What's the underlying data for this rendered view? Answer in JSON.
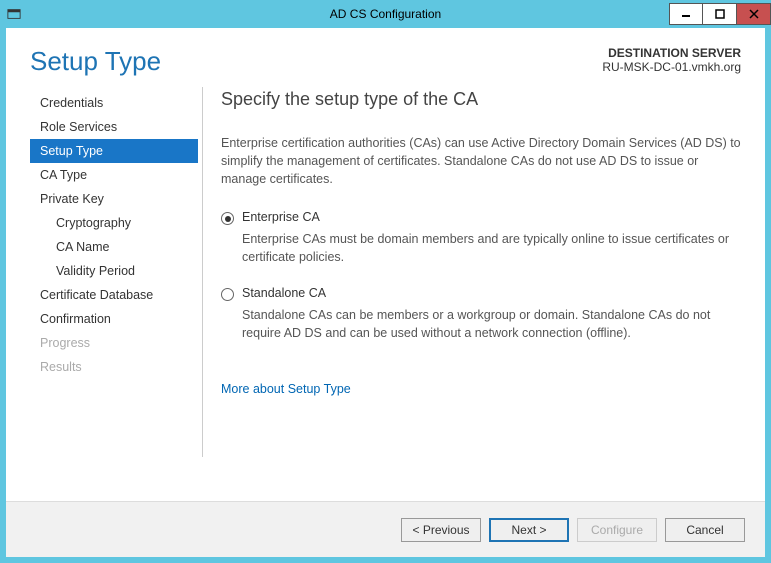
{
  "titlebar": {
    "title": "AD CS Configuration"
  },
  "header": {
    "page_title": "Setup Type",
    "destination_label": "DESTINATION SERVER",
    "destination_value": "RU-MSK-DC-01.vmkh.org"
  },
  "sidebar": {
    "items": [
      {
        "label": "Credentials",
        "indent": false,
        "selected": false,
        "disabled": false
      },
      {
        "label": "Role Services",
        "indent": false,
        "selected": false,
        "disabled": false
      },
      {
        "label": "Setup Type",
        "indent": false,
        "selected": true,
        "disabled": false
      },
      {
        "label": "CA Type",
        "indent": false,
        "selected": false,
        "disabled": false
      },
      {
        "label": "Private Key",
        "indent": false,
        "selected": false,
        "disabled": false
      },
      {
        "label": "Cryptography",
        "indent": true,
        "selected": false,
        "disabled": false
      },
      {
        "label": "CA Name",
        "indent": true,
        "selected": false,
        "disabled": false
      },
      {
        "label": "Validity Period",
        "indent": true,
        "selected": false,
        "disabled": false
      },
      {
        "label": "Certificate Database",
        "indent": false,
        "selected": false,
        "disabled": false
      },
      {
        "label": "Confirmation",
        "indent": false,
        "selected": false,
        "disabled": false
      },
      {
        "label": "Progress",
        "indent": false,
        "selected": false,
        "disabled": true
      },
      {
        "label": "Results",
        "indent": false,
        "selected": false,
        "disabled": true
      }
    ]
  },
  "content": {
    "heading": "Specify the setup type of the CA",
    "description": "Enterprise certification authorities (CAs) can use Active Directory Domain Services (AD DS) to simplify the management of certificates. Standalone CAs do not use AD DS to issue or manage certificates.",
    "options": [
      {
        "label": "Enterprise CA",
        "checked": true,
        "desc": "Enterprise CAs must be domain members and are typically online to issue certificates or certificate policies."
      },
      {
        "label": "Standalone CA",
        "checked": false,
        "desc": "Standalone CAs can be members or a workgroup or domain. Standalone CAs do not require AD DS and can be used without a network connection (offline)."
      }
    ],
    "more_link": "More about Setup Type"
  },
  "footer": {
    "previous": "< Previous",
    "next": "Next >",
    "configure": "Configure",
    "cancel": "Cancel"
  }
}
